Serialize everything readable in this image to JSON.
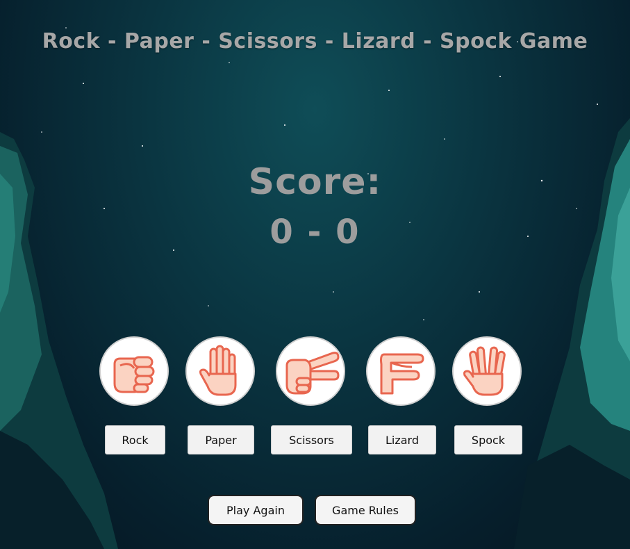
{
  "title": "Rock - Paper - Scissors - Lizard - Spock Game",
  "score": {
    "label": "Score:",
    "value": "0 - 0"
  },
  "choices": [
    {
      "label": "Rock",
      "icon": "fist-icon"
    },
    {
      "label": "Paper",
      "icon": "open-hand-icon"
    },
    {
      "label": "Scissors",
      "icon": "scissors-hand-icon"
    },
    {
      "label": "Lizard",
      "icon": "lizard-hand-icon"
    },
    {
      "label": "Spock",
      "icon": "vulcan-salute-icon"
    }
  ],
  "actions": {
    "play_again": "Play Again",
    "game_rules": "Game Rules"
  },
  "colors": {
    "hand_fill": "#fbd3c2",
    "hand_stroke": "#e8664f",
    "text": "#a7a7a7"
  }
}
